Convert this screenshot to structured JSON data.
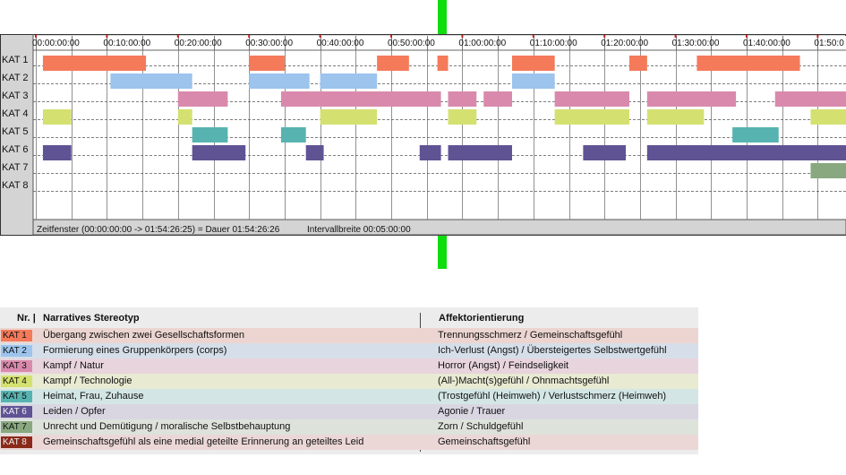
{
  "chart_data": {
    "type": "timeline",
    "categories": [
      "KAT 1",
      "KAT 2",
      "KAT 3",
      "KAT 4",
      "KAT 5",
      "KAT 6",
      "KAT 7",
      "KAT 8"
    ],
    "colors": [
      "#f47a5a",
      "#9cc4ec",
      "#d98aac",
      "#d4e170",
      "#57b3b0",
      "#5f5394",
      "#8aa880",
      "#8a2a1a"
    ],
    "x_unit": "minutes",
    "xlim": [
      0,
      114.44
    ],
    "x_tick_labels": [
      "00:00:00:00",
      "00:10:00:00",
      "00:20:00:00",
      "00:30:00:00",
      "00:40:00:00",
      "00:50:00:00",
      "01:00:00:00",
      "01:10:00:00",
      "01:20:00:00",
      "01:30:00:00",
      "01:40:00:00",
      "01:50:0"
    ],
    "grid_interval_minutes": 5,
    "segments": [
      [
        [
          1,
          15.5
        ],
        [
          30,
          35
        ],
        [
          48,
          52.5
        ],
        [
          56.5,
          58
        ],
        [
          67,
          73
        ],
        [
          83.5,
          86
        ],
        [
          93,
          107.5
        ]
      ],
      [
        [
          10.5,
          22
        ],
        [
          30,
          38.5
        ],
        [
          40,
          48
        ],
        [
          67,
          73
        ]
      ],
      [
        [
          20,
          27
        ],
        [
          34.5,
          57
        ],
        [
          58,
          62
        ],
        [
          63,
          67
        ],
        [
          73,
          83.5
        ],
        [
          86,
          98.5
        ],
        [
          104,
          114.44
        ]
      ],
      [
        [
          1,
          5
        ],
        [
          20,
          22
        ],
        [
          40,
          48
        ],
        [
          58,
          62
        ],
        [
          73,
          83.5
        ],
        [
          86,
          94
        ],
        [
          109,
          114.44
        ]
      ],
      [
        [
          22,
          27
        ],
        [
          34.5,
          38
        ],
        [
          98,
          104.5
        ]
      ],
      [
        [
          1,
          5
        ],
        [
          22,
          29.5
        ],
        [
          38,
          40.5
        ],
        [
          54,
          57
        ],
        [
          58,
          67
        ],
        [
          77,
          83
        ],
        [
          86,
          114.44
        ]
      ],
      [
        [
          109,
          114.44
        ]
      ],
      []
    ]
  },
  "timeline": {
    "footer_window": "Zeitfenster (00:00:00:00 -> 01:54:26:25) = Dauer 01:54:26:26",
    "footer_interval": "Intervallbreite 00:05:00:00"
  },
  "legend": {
    "header_nr": "Nr. |",
    "header_stereotype": "Narratives Stereotyp",
    "header_affect": "Affektorientierung",
    "rows": [
      {
        "badge": "KAT 1",
        "stereotype": "Übergang zwischen zwei Gesellschaftsformen",
        "affect": "Trennungsschmerz / Gemeinschaftsgefühl"
      },
      {
        "badge": "KAT 2",
        "stereotype": "Formierung eines Gruppenkörpers (corps)",
        "affect": "Ich-Verlust (Angst) / Übersteigertes Selbstwertgefühl"
      },
      {
        "badge": "KAT 3",
        "stereotype": "Kampf / Natur",
        "affect": "Horror (Angst) / Feindseligkeit"
      },
      {
        "badge": "KAT 4",
        "stereotype": "Kampf / Technologie",
        "affect": "(All-)Macht(s)gefühl / Ohnmachtsgefühl"
      },
      {
        "badge": "KAT 5",
        "stereotype": "Heimat, Frau, Zuhause",
        "affect": "(Trostgefühl (Heimweh) / Verlustschmerz (Heimweh)"
      },
      {
        "badge": "KAT 6",
        "stereotype": "Leiden / Opfer",
        "affect": "Agonie / Trauer"
      },
      {
        "badge": "KAT 7",
        "stereotype": "Unrecht und Demütigung / moralische Selbstbehauptung",
        "affect": "Zorn / Schuldgefühl"
      },
      {
        "badge": "KAT 8",
        "stereotype": "Gemeinschaftsgefühl als eine medial geteilte Erinnerung an geteiltes Leid",
        "affect": "Gemeinschaftsgefühl"
      }
    ],
    "row_tints": [
      "#ecd5d0",
      "#d6dfe9",
      "#e8d4dd",
      "#e8ead2",
      "#d3e6e5",
      "#d9d6e2",
      "#dde3db",
      "#ecd7d7"
    ]
  }
}
